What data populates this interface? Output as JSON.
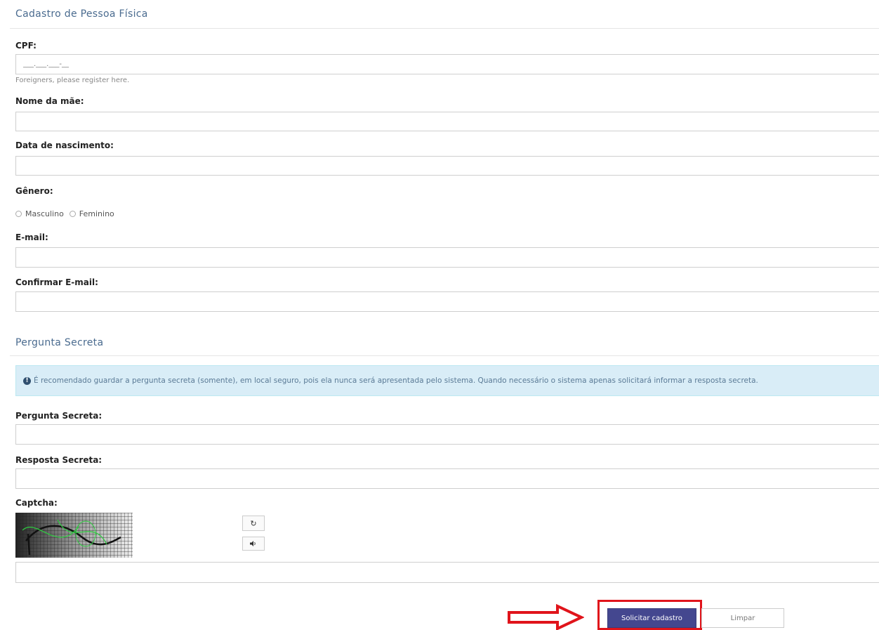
{
  "person_section": {
    "legend": "Cadastro de Pessoa Física",
    "cpf": {
      "label": "CPF:",
      "placeholder": "___.___.___-__"
    },
    "foreigners_hint": "Foreigners, please register here.",
    "mother_name": {
      "label": "Nome da mãe:"
    },
    "birth_date": {
      "label": "Data de nascimento:"
    },
    "gender": {
      "label": "Gênero:",
      "options": [
        "Masculino",
        "Feminino"
      ]
    },
    "email": {
      "label": "E-mail:"
    },
    "confirm_email": {
      "label": "Confirmar E-mail:"
    }
  },
  "secret_section": {
    "legend": "Pergunta Secreta",
    "info": "É recomendado guardar a pergunta secreta (somente), em local seguro, pois ela nunca será apresentada pelo sistema. Quando necessário o sistema apenas solicitará informar a resposta secreta.",
    "question": {
      "label": "Pergunta Secreta:"
    },
    "answer": {
      "label": "Resposta Secreta:"
    }
  },
  "captcha": {
    "label": "Captcha:"
  },
  "actions": {
    "submit_label": "Solicitar cadastro",
    "clear_label": "Limpar"
  },
  "colors": {
    "submit_bg": "#44478f",
    "highlight": "#e0141b",
    "alert_bg": "#d9edf7"
  },
  "icons": {
    "refresh": "refresh-icon",
    "audio": "audio-icon",
    "info": "info-icon",
    "arrow": "arrow-right-icon"
  }
}
